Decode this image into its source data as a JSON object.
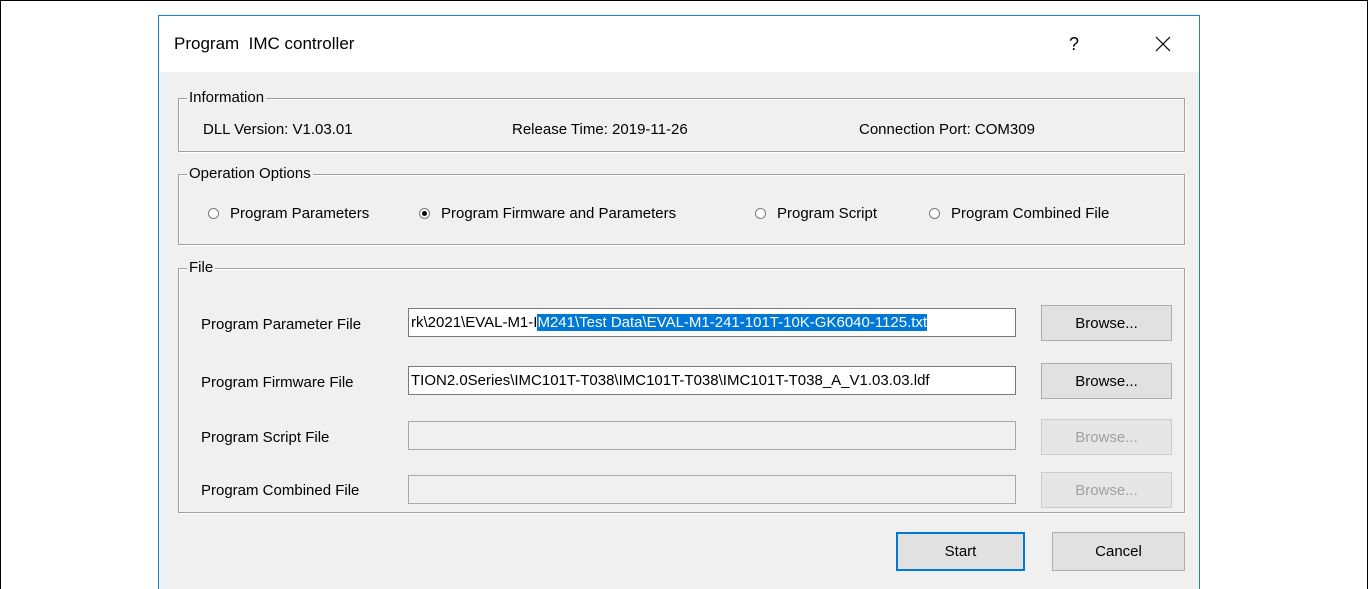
{
  "dialog": {
    "title": "Program  IMC controller",
    "help_label": "?",
    "close_icon": "close-icon"
  },
  "information": {
    "label": "Information",
    "dll_version": "DLL Version: V1.03.01",
    "release_time": "Release Time: 2019-11-26",
    "connection_port": "Connection Port: COM309"
  },
  "operation_options": {
    "label": "Operation Options",
    "options": [
      {
        "label": "Program Parameters",
        "selected": false
      },
      {
        "label": "Program Firmware and Parameters",
        "selected": true
      },
      {
        "label": "Program Script",
        "selected": false
      },
      {
        "label": "Program Combined File",
        "selected": false
      }
    ]
  },
  "file": {
    "label": "File",
    "rows": [
      {
        "label": "Program Parameter File",
        "value_plain": "rk\\2021\\EVAL-M1-I",
        "value_selected": "M241\\Test Data\\EVAL-M1-241-101T-10K-GK6040-1125.txt",
        "browse_label": "Browse...",
        "enabled": true
      },
      {
        "label": "Program Firmware File",
        "value_plain": "TION2.0Series\\IMC101T-T038\\IMC101T-T038\\IMC101T-T038_A_V1.03.03.ldf",
        "value_selected": "",
        "browse_label": "Browse...",
        "enabled": true
      },
      {
        "label": "Program Script File",
        "value_plain": "",
        "value_selected": "",
        "browse_label": "Browse...",
        "enabled": false
      },
      {
        "label": "Program Combined File",
        "value_plain": "",
        "value_selected": "",
        "browse_label": "Browse...",
        "enabled": false
      }
    ]
  },
  "footer": {
    "start_label": "Start",
    "cancel_label": "Cancel"
  },
  "colors": {
    "accent": "#0078d7",
    "window_border": "#1883d7",
    "dialog_bg": "#f0f0f0"
  }
}
